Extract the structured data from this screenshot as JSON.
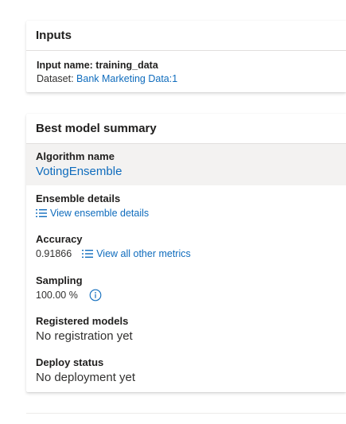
{
  "inputs": {
    "title": "Inputs",
    "input_name": "Input name: training_data",
    "dataset_label": "Dataset: ",
    "dataset_link": "Bank Marketing Data:1"
  },
  "summary": {
    "title": "Best model summary",
    "algorithm": {
      "label": "Algorithm name",
      "value": "VotingEnsemble"
    },
    "ensemble": {
      "label": "Ensemble details",
      "link": "View ensemble details"
    },
    "accuracy": {
      "label": "Accuracy",
      "value": "0.91866",
      "link": "View all other metrics"
    },
    "sampling": {
      "label": "Sampling",
      "value": "100.00 %"
    },
    "registered": {
      "label": "Registered models",
      "value": "No registration yet"
    },
    "deploy": {
      "label": "Deploy status",
      "value": "No deployment yet"
    }
  },
  "colors": {
    "link": "#0f6cbd",
    "highlight_bg": "#f3f2f1"
  },
  "icons": {
    "list": "list-icon",
    "info": "info-icon"
  }
}
